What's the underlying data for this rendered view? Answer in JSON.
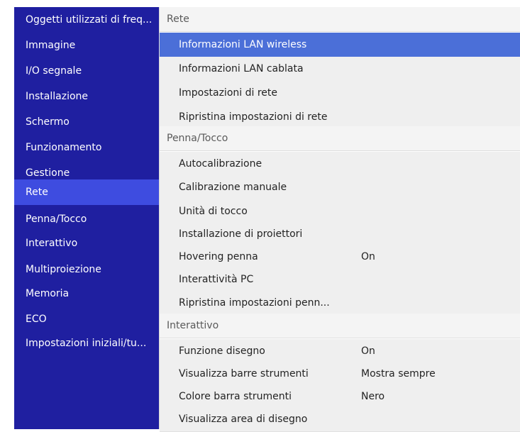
{
  "sidebar": {
    "items": [
      {
        "label": "Oggetti utilizzati di freq..."
      },
      {
        "label": "Immagine"
      },
      {
        "label": "I/O segnale"
      },
      {
        "label": "Installazione"
      },
      {
        "label": "Schermo"
      },
      {
        "label": "Funzionamento"
      },
      {
        "label": "Gestione"
      },
      {
        "label": "Rete"
      },
      {
        "label": "Penna/Tocco"
      },
      {
        "label": "Interattivo"
      },
      {
        "label": "Multiproiezione"
      },
      {
        "label": "Memoria"
      },
      {
        "label": "ECO"
      },
      {
        "label": "Impostazioni iniziali/tu..."
      }
    ]
  },
  "content": {
    "sections": {
      "rete": {
        "header": "Rete",
        "items": [
          {
            "label": "Informazioni LAN wireless"
          },
          {
            "label": "Informazioni LAN cablata"
          },
          {
            "label": "Impostazioni di rete"
          },
          {
            "label": "Ripristina impostazioni di rete"
          }
        ]
      },
      "penna": {
        "header": "Penna/Tocco",
        "items": [
          {
            "label": "Autocalibrazione"
          },
          {
            "label": "Calibrazione manuale"
          },
          {
            "label": "Unità di tocco"
          },
          {
            "label": "Installazione di proiettori"
          },
          {
            "label": "Hovering penna",
            "value": "On"
          },
          {
            "label": "Interattività PC"
          },
          {
            "label": "Ripristina impostazioni penn..."
          }
        ]
      },
      "interattivo": {
        "header": "Interattivo",
        "items": [
          {
            "label": "Funzione disegno",
            "value": "On"
          },
          {
            "label": "Visualizza barre strumenti",
            "value": "Mostra sempre"
          },
          {
            "label": "Colore barra strumenti",
            "value": "Nero"
          },
          {
            "label": "Visualizza area di disegno"
          }
        ]
      }
    }
  },
  "colors": {
    "sidebar_bg": "#1f1fa0",
    "sidebar_selected": "#3e4ce0",
    "content_selected": "#4b6fd8"
  }
}
